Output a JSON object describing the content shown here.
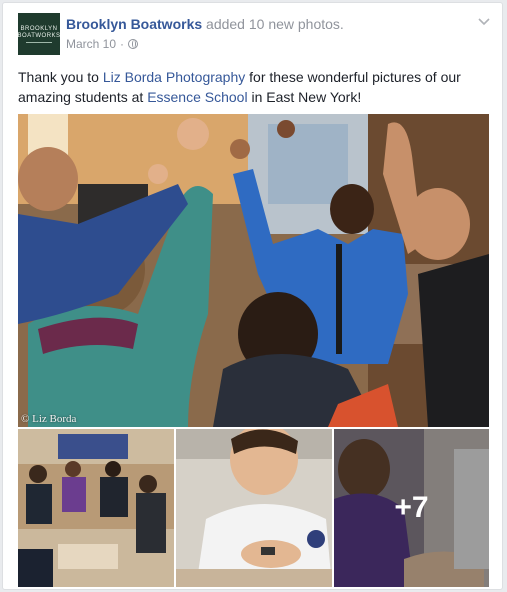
{
  "post": {
    "page_name": "Brooklyn Boatworks",
    "action_text": " added 10 new photos.",
    "date": "March 10",
    "date_separator": "·",
    "privacy_icon": "globe-icon",
    "menu_icon": "chevron-down-icon",
    "avatar_lines": [
      "BROOKLYN",
      "BOATWORKS"
    ],
    "text": {
      "part1": "Thank you to ",
      "link1": "Liz Borda Photography",
      "part2": " for these wonderful pictures of our amazing students at ",
      "link2": "Essence School",
      "part3": " in East New York!"
    },
    "photos": {
      "credit": "© Liz Borda",
      "more_count": "+7"
    }
  },
  "colors": {
    "link": "#365899",
    "meta": "#90949c",
    "text": "#1d2129",
    "background": "#e9ebee"
  }
}
